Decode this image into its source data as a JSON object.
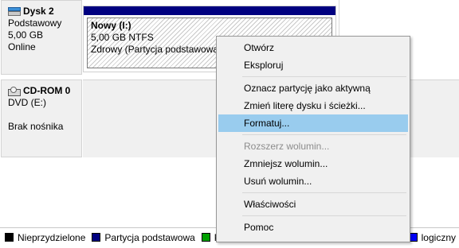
{
  "disk2": {
    "title": "Dysk 2",
    "type": "Podstawowy",
    "size": "5,00 GB",
    "status": "Online",
    "partition": {
      "name": "Nowy  (I:)",
      "size_fs": "5,00 GB NTFS",
      "health": "Zdrowy (Partycja podstawowa)"
    }
  },
  "cdrom0": {
    "title": "CD-ROM 0",
    "drive": "DVD (E:)",
    "media": "Brak nośnika"
  },
  "context_menu": {
    "items": [
      {
        "label": "Otwórz",
        "state": "normal"
      },
      {
        "label": "Eksploruj",
        "state": "normal"
      },
      {
        "label": "Oznacz partycję jako aktywną",
        "state": "normal"
      },
      {
        "label": "Zmień literę dysku i ścieżki...",
        "state": "normal"
      },
      {
        "label": "Formatuj...",
        "state": "highlighted"
      },
      {
        "label": "Rozszerz wolumin...",
        "state": "disabled"
      },
      {
        "label": "Zmniejsz wolumin...",
        "state": "normal"
      },
      {
        "label": "Usuń wolumin...",
        "state": "normal"
      },
      {
        "label": "Właściwości",
        "state": "normal"
      },
      {
        "label": "Pomoc",
        "state": "normal"
      }
    ]
  },
  "legend": {
    "items": [
      {
        "label": "Nieprzydzielone",
        "color": "#000000"
      },
      {
        "label": "Partycja podstawowa",
        "color": "#000080"
      },
      {
        "label": "P",
        "color": "#00a000"
      },
      {
        "label": "logiczny",
        "color": "#0000ff"
      }
    ]
  },
  "colors": {
    "partition_bar": "#000080",
    "menu_highlight": "#99ccee"
  }
}
